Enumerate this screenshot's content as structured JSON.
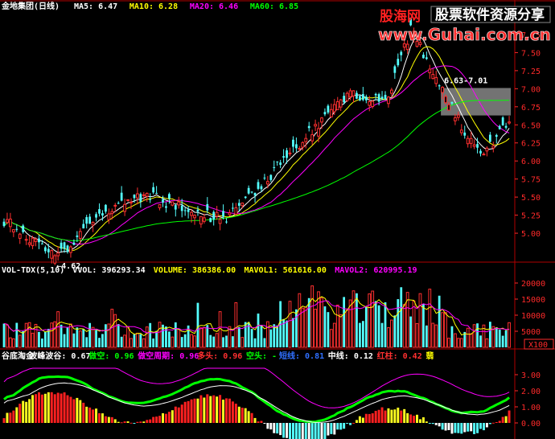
{
  "chart_data": [
    {
      "type": "candlestick",
      "title": "金地集团(日线)",
      "indicators": [
        {
          "label": "MA5:",
          "value": "6.47",
          "color": "#ffffff"
        },
        {
          "label": "MA10:",
          "value": "6.28",
          "color": "#ffff00"
        },
        {
          "label": "MA20:",
          "value": "6.46",
          "color": "#ff00ff"
        },
        {
          "label": "MA60:",
          "value": "6.85",
          "color": "#00ff00"
        }
      ],
      "yticks": [
        "7.75",
        "7.50",
        "7.25",
        "7.00",
        "6.75",
        "6.50",
        "6.25",
        "6.00",
        "5.75",
        "5.50",
        "5.25",
        "5.00"
      ],
      "ylim": [
        4.6,
        8.05
      ],
      "annotations": [
        {
          "text": "←4.62",
          "price": 4.62,
          "bar": 17
        },
        {
          "text": "6.63-7.01",
          "low": 6.63,
          "high": 7.01,
          "bar_start": 138,
          "bar_end": 159
        }
      ],
      "summary": {
        "bars": 160,
        "start_close": 5.18,
        "low": 4.62,
        "peak_bar": 128,
        "peak_high": 7.95,
        "last_close": 6.54
      }
    },
    {
      "type": "bar",
      "title_items": [
        {
          "text": "VOL-TDX(5,10)",
          "color": "#ffffff"
        },
        {
          "text": "VVOL: 396293.34",
          "color": "#ffffff"
        },
        {
          "text": "VOLUME: 386386.00",
          "color": "#ffff00"
        },
        {
          "text": "MAVOL1: 561616.00",
          "color": "#ffff00"
        },
        {
          "text": "MAVOL2: 620995.19",
          "color": "#ff00ff"
        }
      ],
      "yticks": [
        "20000",
        "15000",
        "10000",
        "5000"
      ],
      "unit": "X100",
      "ylim": [
        0,
        22500
      ]
    },
    {
      "type": "bar",
      "title_items": [
        {
          "text": "谷底淘金",
          "color": "#ffffff"
        },
        {
          "text": "波峰波谷: 0.67",
          "color": "#ffffff"
        },
        {
          "text": "做空: 0.96",
          "color": "#00ff00"
        },
        {
          "text": "做空周期: 0.96",
          "color": "#ff00ff"
        },
        {
          "text": "多头: 0.96",
          "color": "#ff3030"
        },
        {
          "text": "空头: -",
          "color": "#00ff00"
        },
        {
          "text": "短线: 0.81",
          "color": "#3070ff"
        },
        {
          "text": "中线: 0.12",
          "color": "#ffffff"
        },
        {
          "text": "红柱: 0.42",
          "color": "#ff3030"
        },
        {
          "text": "翡",
          "color": "#ffff00"
        }
      ],
      "yticks": [
        "3.00",
        "2.00",
        "1.00",
        "0.00"
      ],
      "ylim": [
        -0.9,
        3.9
      ]
    }
  ],
  "watermark": {
    "brand": "股海网",
    "slogan": "股票软件资源分享",
    "url": "www.Guhai.com.cn"
  }
}
